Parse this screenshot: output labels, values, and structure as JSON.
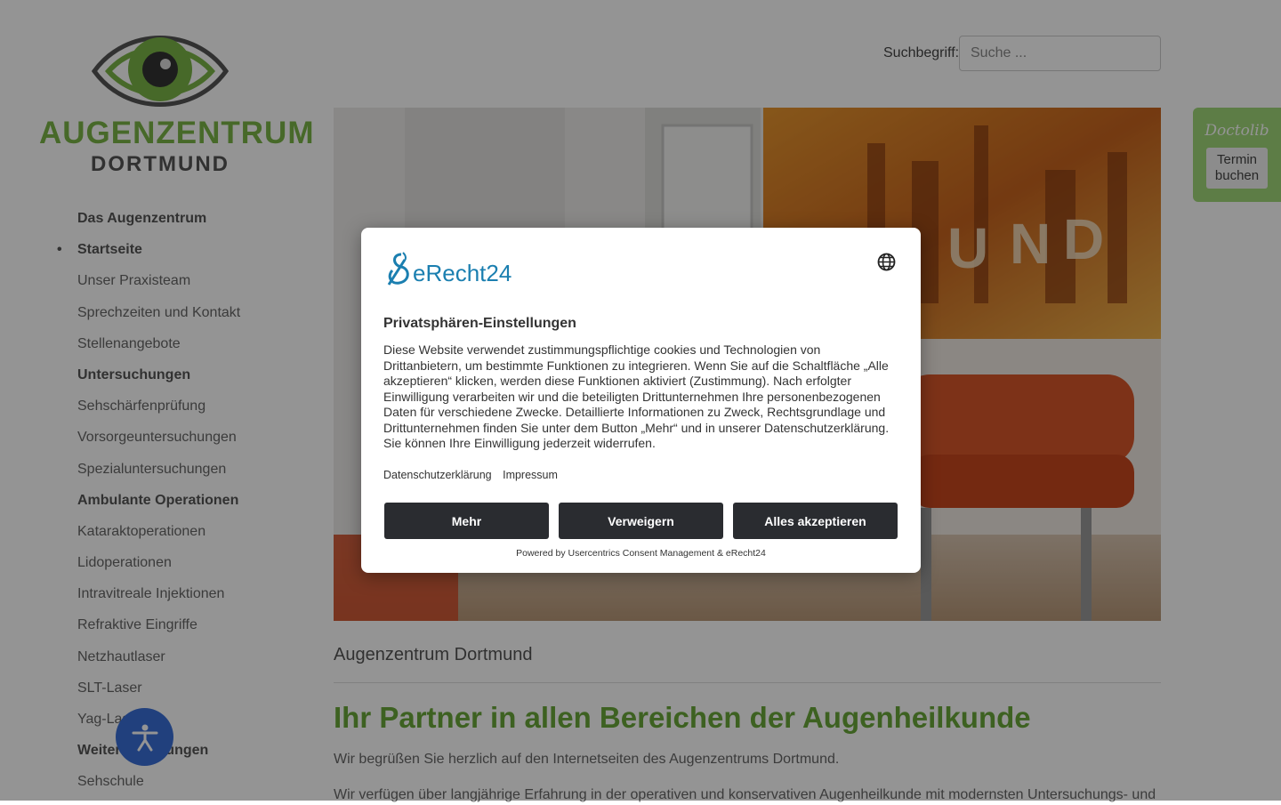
{
  "logo": {
    "line1": "AUGENZENTRUM",
    "line2": "DORTMUND"
  },
  "search": {
    "label": "Suchbegriff:",
    "placeholder": "Suche ..."
  },
  "nav": [
    {
      "label": "Das Augenzentrum",
      "type": "heading"
    },
    {
      "label": "Startseite",
      "type": "heading",
      "active": true
    },
    {
      "label": "Unser Praxisteam",
      "type": "link"
    },
    {
      "label": "Sprechzeiten und Kontakt",
      "type": "link"
    },
    {
      "label": "Stellenangebote",
      "type": "link"
    },
    {
      "label": "Untersuchungen",
      "type": "heading"
    },
    {
      "label": "Sehschärfenprüfung",
      "type": "link"
    },
    {
      "label": "Vorsorgeuntersuchungen",
      "type": "link"
    },
    {
      "label": "Spezialuntersuchungen",
      "type": "link"
    },
    {
      "label": "Ambulante Operationen",
      "type": "heading"
    },
    {
      "label": "Kataraktoperationen",
      "type": "link"
    },
    {
      "label": "Lidoperationen",
      "type": "link"
    },
    {
      "label": "Intravitreale Injektionen",
      "type": "link"
    },
    {
      "label": "Refraktive Eingriffe",
      "type": "link"
    },
    {
      "label": "Netzhautlaser",
      "type": "link"
    },
    {
      "label": "SLT-Laser",
      "type": "link"
    },
    {
      "label": "Yag-Laser",
      "type": "link"
    },
    {
      "label": "Weitere Leistungen",
      "type": "heading"
    },
    {
      "label": "Sehschule",
      "type": "link"
    }
  ],
  "doctolib": {
    "brand": "Doctolib",
    "button": "Termin buchen"
  },
  "main": {
    "section_title": "Augenzentrum Dortmund",
    "headline": "Ihr Partner in allen Bereichen der Augenheilkunde",
    "intro1": "Wir begrüßen Sie herzlich auf den Internetseiten des Augenzentrums Dortmund.",
    "intro2": "Wir verfügen über langjährige Erfahrung in der operativen und konservativen Augenheilkunde mit modernsten Untersuchungs- und"
  },
  "consent": {
    "brand": "eRecht24",
    "title": "Privatsphären-Einstellungen",
    "body": "Diese Website verwendet zustimmungspflichtige cookies und Technologien von Drittanbietern, um bestimmte Funktionen zu integrieren. Wenn Sie auf die Schaltfläche „Alle akzeptieren“ klicken, werden diese Funktionen aktiviert (Zustimmung). Nach erfolgter Einwilligung verarbeiten wir und die beteiligten Drittunternehmen Ihre personenbezogenen Daten für verschiedene Zwecke. Detaillierte Informationen zu Zweck, Rechtsgrundlage und Drittunternehmen finden Sie unter dem Button „Mehr“ und in unserer Datenschutzerklärung. Sie können Ihre Einwilligung jederzeit widerrufen.",
    "links": [
      "Datenschutzerklärung",
      "Impressum"
    ],
    "buttons": {
      "more": "Mehr",
      "deny": "Verweigern",
      "accept": "Alles akzeptieren"
    },
    "powered": "Powered by Usercentrics Consent Management & eRecht24"
  },
  "icons": {
    "language": "globe-icon",
    "accessibility": "accessibility-icon",
    "eye_logo": "eye-icon"
  },
  "colors": {
    "brand_green": "#7ab648",
    "headline_green": "#6aa83a",
    "doctolib_green": "#a0d879",
    "accessibility_blue": "#3a6fd8",
    "consent_button": "#2a2c30",
    "erecht_blue": "#1b7fb0"
  }
}
